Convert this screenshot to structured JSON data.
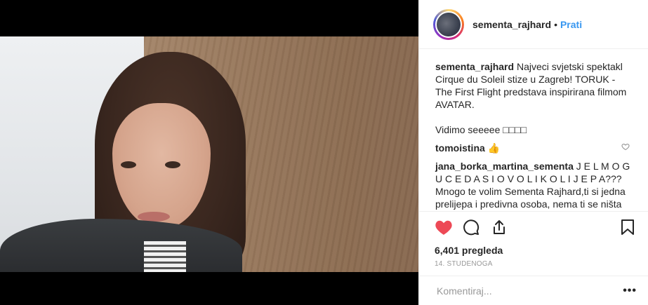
{
  "header": {
    "username": "sementa_rajhard",
    "separator": "•",
    "follow_label": "Prati"
  },
  "caption": {
    "username": "sementa_rajhard",
    "text": "Najveci svjetski spektakl Cirque du Soleil stize u Zagreb! TORUK - The First Flight predstava inspirirana filmom AVATAR.\n\nVidimo seeeee □□□□"
  },
  "comments": [
    {
      "username": "tomoistina",
      "text": "👍"
    },
    {
      "username": "jana_borka_martina_sementa",
      "text": "J E L M O G U C E D A S I O V O L I K O L I J E P A??? Mnogo te volim Sementa Rajhard,ti si jedna prelijepa i predivna osoba, nema ti se ništa zamjerit"
    }
  ],
  "stats": {
    "views": "6,401 pregleda",
    "date": "14. STUDENOGA"
  },
  "comment_box": {
    "placeholder": "Komentiraj...",
    "more": "•••"
  },
  "icons": {
    "like": "heart-icon",
    "comment": "comment-bubble-icon",
    "share": "share-icon",
    "save": "bookmark-icon",
    "comment_like": "heart-outline-icon"
  },
  "colors": {
    "link": "#3897f0",
    "like_red": "#ed4956",
    "text": "#262626",
    "muted": "#999999"
  }
}
